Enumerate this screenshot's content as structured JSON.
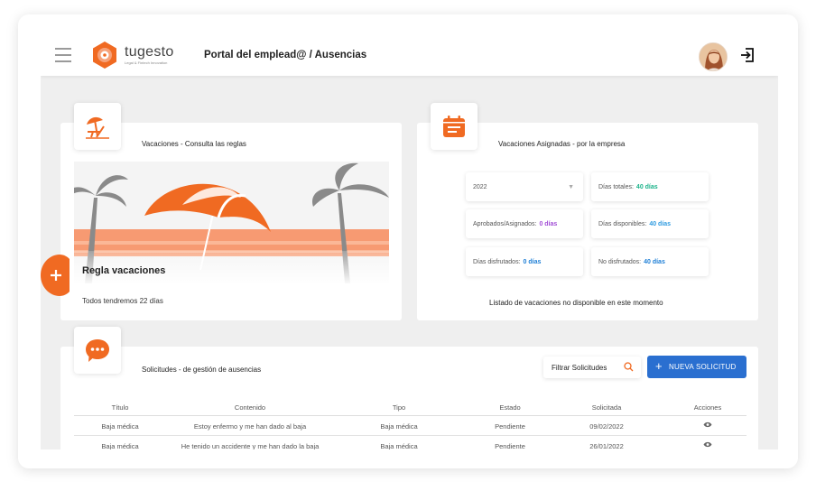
{
  "header": {
    "brand_name": "tugesto",
    "brand_tagline": "Legal & Fintech Innovation",
    "page_title": "Portal del emplead@ / Ausencias",
    "icons": {
      "menu": "hamburger-icon",
      "logout": "logout-icon"
    }
  },
  "rules_card": {
    "title": "Vacaciones - Consulta las reglas",
    "icon": "beach-chair-icon",
    "rule_title": "Regla vacaciones",
    "rule_text": "Todos tendremos 22 días"
  },
  "assigned_card": {
    "title": "Vacaciones Asignadas - por la empresa",
    "icon": "calendar-icon",
    "year_select": "2022",
    "stats": [
      {
        "label": "Días totales:",
        "value": "40 días",
        "color": "#1bb38a"
      },
      {
        "label": "Aprobados/Asignados:",
        "value": "0 días",
        "color": "#a24fd6"
      },
      {
        "label": "Días disponibles:",
        "value": "40 días",
        "color": "#2f9be0"
      },
      {
        "label": "Días disfrutados:",
        "value": "0 días",
        "color": "#1e7fd6"
      },
      {
        "label": "No disfrutados:",
        "value": "40 días",
        "color": "#1e7fd6"
      }
    ],
    "unavailable_message": "Listado de vacaciones no disponible en este momento"
  },
  "requests_card": {
    "title": "Solicitudes - de gestión de ausencias",
    "icon": "chat-bubble-icon",
    "filter_label": "Filtrar Solicitudes",
    "new_button_label": "NUEVA SOLICITUD",
    "columns": [
      "Título",
      "Contenido",
      "Tipo",
      "Estado",
      "Solicitada",
      "Acciones"
    ],
    "rows": [
      {
        "titulo": "Baja médica",
        "contenido": "Estoy enfermo y me han dado al baja",
        "tipo": "Baja médica",
        "estado": "Pendiente",
        "solicitada": "09/02/2022"
      },
      {
        "titulo": "Baja médica",
        "contenido": "He tenido un accidente y me han dado la baja",
        "tipo": "Baja médica",
        "estado": "Pendiente",
        "solicitada": "26/01/2022"
      }
    ]
  },
  "colors": {
    "accent": "#f06a22",
    "primary_button": "#2a6fd0",
    "background": "#efefef"
  }
}
